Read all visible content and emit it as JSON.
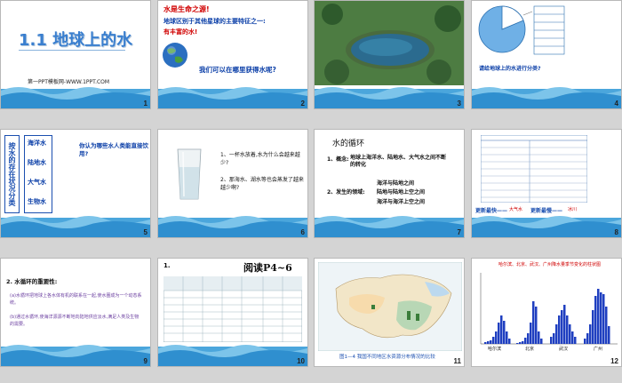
{
  "colors": {
    "accent_blue": "#0b3fa8",
    "accent_red": "#d00000",
    "water": "#4ba6dc",
    "bg": "#d4d4d4"
  },
  "slides": [
    {
      "num": "1",
      "title": "1.1 地球上的水",
      "footer": "第一PPT模板网-WWW.1PPT.COM"
    },
    {
      "num": "2",
      "line1": "水是生命之源!",
      "line2": "地球区别于其他星球的主要特征之一:",
      "line3": "有丰富的水!",
      "question": "我们可以在哪里获得水呢?"
    },
    {
      "num": "3"
    },
    {
      "num": "4",
      "question": "请给地球上的水进行分类?"
    },
    {
      "num": "5",
      "vertical": "按水的存在状况分类",
      "items": [
        "海洋水",
        "陆地水",
        "大气水",
        "生物水"
      ],
      "question": "你认为哪些水人类能直接饮用?"
    },
    {
      "num": "6",
      "q1": "1、一杯水放着,水为什么会越来越少?",
      "q2": "2、那海水、湖水等也会蒸发了越来越少啊?"
    },
    {
      "num": "7",
      "title": "水的循环",
      "concept_label": "1、概念:",
      "concept": "地球上海洋水、陆地水、大气水之间不断的转化",
      "sea_land": "海洋与陆地之间",
      "scope_label": "2、发生的领域:",
      "land_land": "陆地与陆地上空之间",
      "sea_sea": "海洋与海洋上空之间"
    },
    {
      "num": "8",
      "fastest": "更新最快——",
      "fastest_val": "大气水",
      "slowest": "更新最慢——",
      "slowest_val": "冰川"
    },
    {
      "num": "9",
      "title": "2. 水循环的重要性:",
      "p1": "(a)水循环把地球上各水体有机的联系在一起,使水圈成为一个动态系统。",
      "p2": "(b)通过水循环,使海洋源源不断地向陆地供应淡水,满足人类及生物的需要。"
    },
    {
      "num": "10",
      "label": "1.",
      "title": "阅读P4~6"
    },
    {
      "num": "11",
      "caption": "图1—4  我国不同地区水资源分布情况的比较"
    },
    {
      "num": "12",
      "title": "哈尔滨、北京、武汉、广州降水量季节变化的柱状图",
      "cities": [
        "哈尔滨",
        "北京",
        "武汉",
        "广州"
      ]
    }
  ]
}
